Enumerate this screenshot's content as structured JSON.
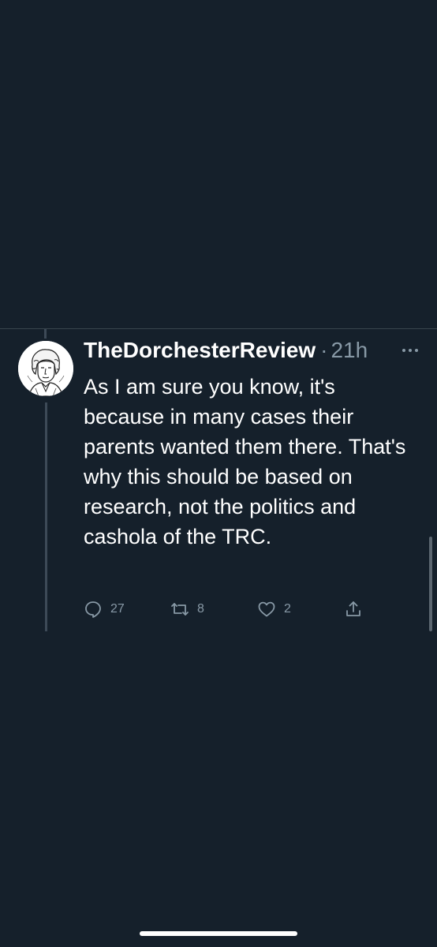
{
  "tweet": {
    "display_name": "TheDorchesterReview",
    "separator": "·",
    "time": "21h",
    "text": "As I am sure you know, it's because in many cases their parents wanted them there. That's why this should be based on research, not the politics and cashola of the TRC.",
    "avatar_icon": "portrait-sketch-avatar"
  },
  "actions": {
    "replies": "27",
    "retweets": "8",
    "likes": "2",
    "reply_icon": "reply-icon",
    "retweet_icon": "retweet-icon",
    "like_icon": "heart-icon",
    "share_icon": "share-icon"
  },
  "colors": {
    "background": "#15202b",
    "secondary_text": "#8899a6",
    "divider": "#38444d"
  }
}
